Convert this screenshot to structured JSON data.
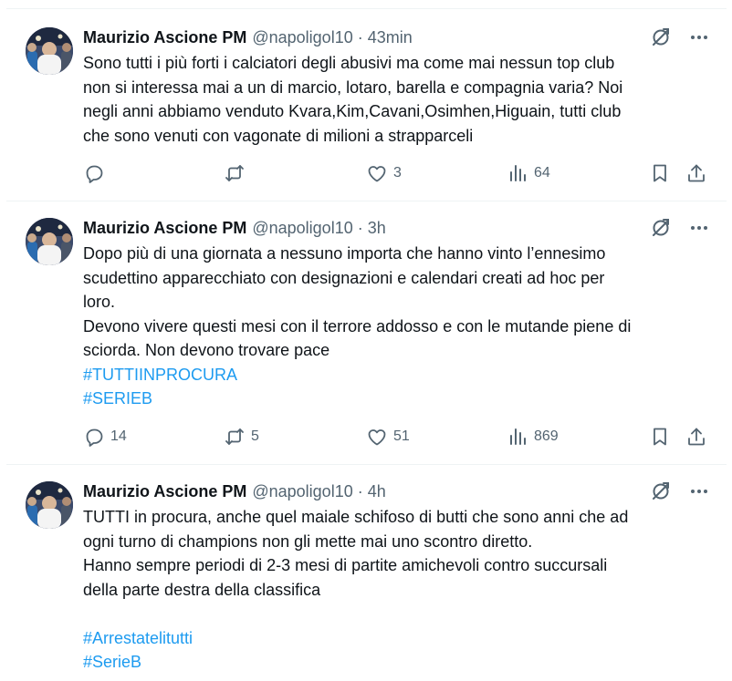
{
  "tweets": [
    {
      "author": "Maurizio Ascione PM",
      "handle": "@napoligol10",
      "separator": "·",
      "time": "43min",
      "lines": [
        {
          "text": "Sono tutti i più forti i calciatori degli abusivi ma come mai nessun top club",
          "tag": false
        },
        {
          "text": "non si interessa mai a un di marcio, lotaro, barella e compagnia varia? Noi",
          "tag": false
        },
        {
          "text": "negli anni abbiamo venduto Kvara,Kim,Cavani,Osimhen,Higuain, tutti club",
          "tag": false
        },
        {
          "text": "che sono venuti con vagonate di milioni a strapparceli",
          "tag": false
        }
      ],
      "replies": "",
      "reposts": "",
      "likes": "3",
      "views": "64"
    },
    {
      "author": "Maurizio Ascione PM",
      "handle": "@napoligol10",
      "separator": "·",
      "time": "3h",
      "lines": [
        {
          "text": "Dopo più di una giornata a nessuno importa che hanno vinto l’ennesimo",
          "tag": false
        },
        {
          "text": "scudettino apparecchiato con designazioni e calendari creati ad hoc per",
          "tag": false
        },
        {
          "text": "loro.",
          "tag": false
        },
        {
          "text": "Devono vivere questi mesi con il terrore addosso e con le mutande piene di",
          "tag": false
        },
        {
          "text": "sciorda. Non devono trovare pace",
          "tag": false
        },
        {
          "text": "#TUTTIINPROCURA",
          "tag": true
        },
        {
          "text": "#SERIEB",
          "tag": true
        }
      ],
      "replies": "14",
      "reposts": "5",
      "likes": "51",
      "views": "869"
    },
    {
      "author": "Maurizio Ascione PM",
      "handle": "@napoligol10",
      "separator": "·",
      "time": "4h",
      "lines": [
        {
          "text": "TUTTI in procura, anche quel maiale schifoso di butti che sono anni che ad",
          "tag": false
        },
        {
          "text": "ogni turno di champions non gli mette mai uno scontro diretto.",
          "tag": false
        },
        {
          "text": "Hanno sempre periodi di 2-3 mesi di partite amichevoli contro succursali",
          "tag": false
        },
        {
          "text": "della parte destra della classifica",
          "tag": false
        },
        {
          "text": "",
          "tag": false
        },
        {
          "text": "#Arrestatelitutti",
          "tag": true
        },
        {
          "text": "#SerieB",
          "tag": true
        }
      ],
      "replies": "",
      "reposts": "",
      "likes": "",
      "views": ""
    }
  ],
  "colors": {
    "text": "#0f1419",
    "secondary": "#536471",
    "hashtag": "#1d9bf0",
    "divider": "#eff3f4"
  },
  "icons": [
    "grok-slash-icon",
    "more-icon",
    "reply-icon",
    "repost-icon",
    "like-icon",
    "views-icon",
    "bookmark-icon",
    "share-icon"
  ]
}
